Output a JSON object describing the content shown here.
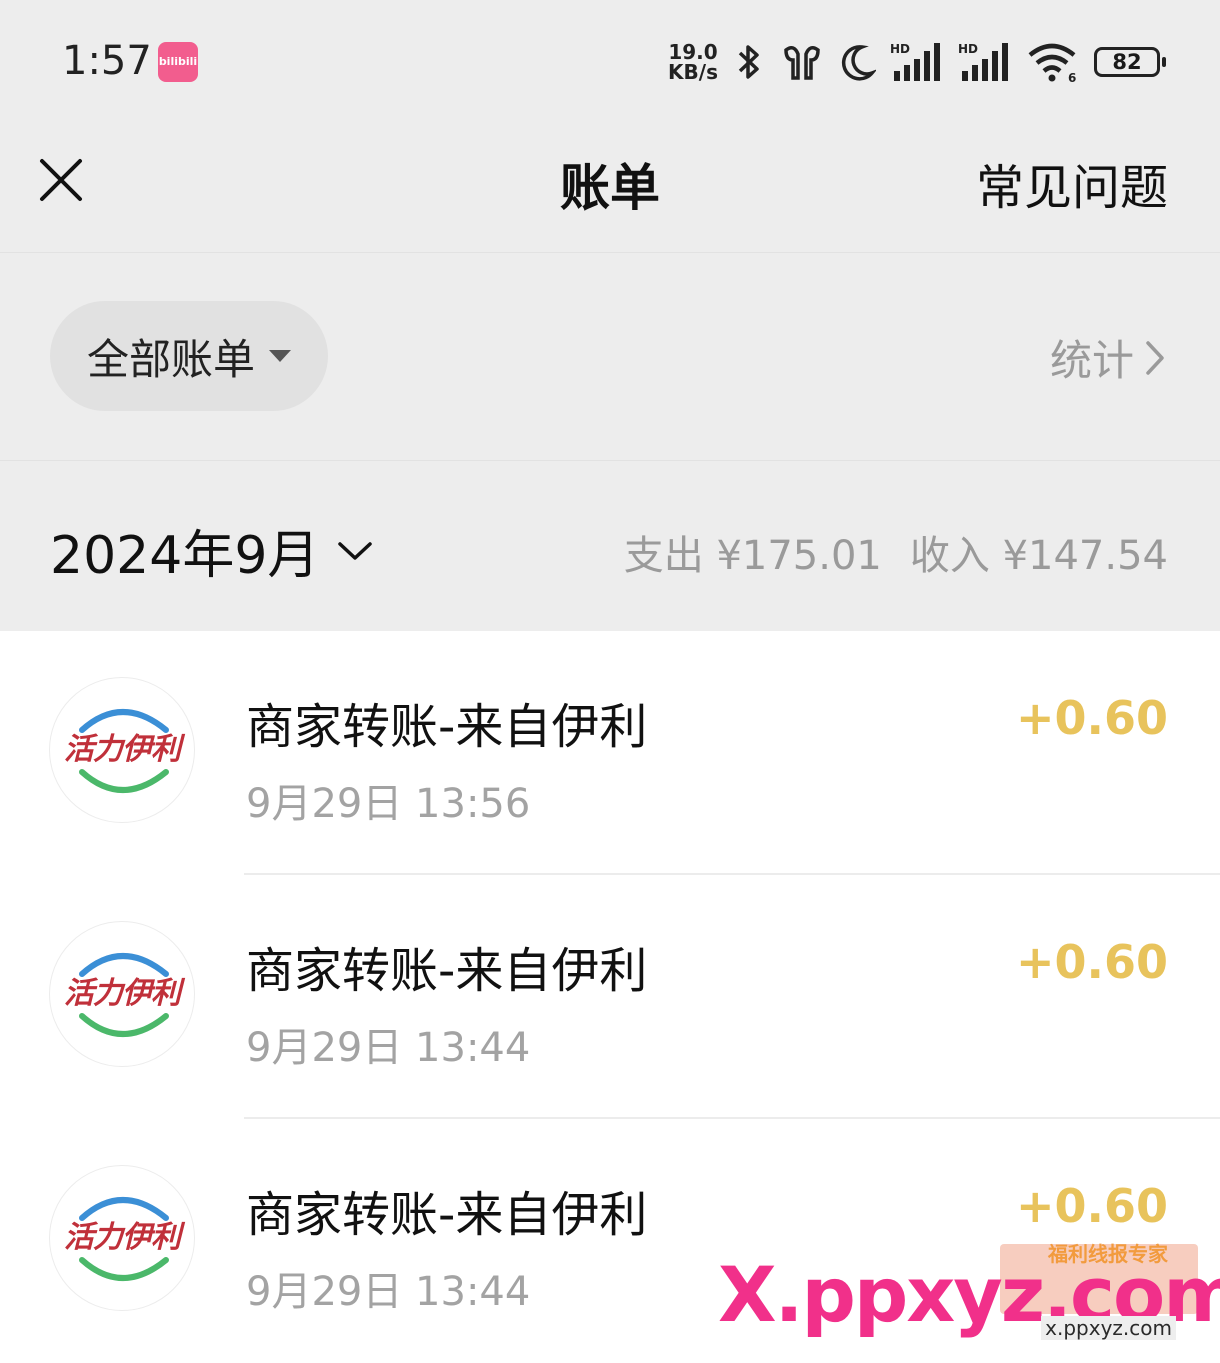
{
  "status_bar": {
    "time": "1:57",
    "app_badge": "bilibili",
    "net_speed_value": "19.0",
    "net_speed_unit": "KB/s",
    "battery": "82"
  },
  "nav": {
    "title": "账单",
    "faq": "常见问题"
  },
  "filter": {
    "label": "全部账单",
    "stats": "统计"
  },
  "month": {
    "label": "2024年9月",
    "expense": "支出 ¥175.01",
    "income": "收入 ¥147.54"
  },
  "transactions": [
    {
      "avatar_text": "活力伊利",
      "title": "商家转账-来自伊利",
      "time": "9月29日 13:56",
      "amount": "+0.60"
    },
    {
      "avatar_text": "活力伊利",
      "title": "商家转账-来自伊利",
      "time": "9月29日 13:44",
      "amount": "+0.60"
    },
    {
      "avatar_text": "活力伊利",
      "title": "商家转账-来自伊利",
      "time": "9月29日 13:44",
      "amount": "+0.60"
    }
  ],
  "watermark": {
    "text": "X.ppxyz.com",
    "sub": "x.ppxyz.com",
    "tag": "福利线报专家"
  },
  "colors": {
    "background": "#ededed",
    "amount": "#e8c35c",
    "muted": "#9a9a9a",
    "watermark": "#f1308a"
  },
  "icons": [
    "close-icon",
    "caret-down-icon",
    "chevron-right-icon",
    "chevron-down-icon",
    "bluetooth-icon",
    "earbuds-icon",
    "moon-icon",
    "signal-icon",
    "wifi-icon",
    "battery-icon"
  ]
}
